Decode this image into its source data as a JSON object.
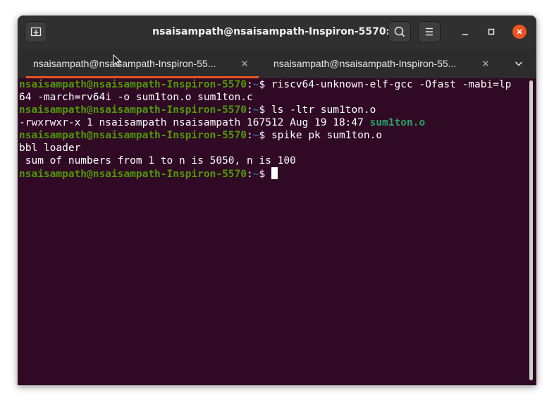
{
  "window": {
    "title": "nsaisampath@nsaisampath-Inspiron-5570: ~"
  },
  "tabs": [
    {
      "label": "nsaisampath@nsaisampath-Inspiron-55...",
      "active": true
    },
    {
      "label": "nsaisampath@nsaisampath-Inspiron-55...",
      "active": false
    }
  ],
  "colors": {
    "terminal_bg": "#300a24",
    "prompt_user": "#4e9a06",
    "prompt_path": "#3465a4",
    "accent": "#e95420"
  },
  "terminal": {
    "prompt_user_host": "nsaisampath@nsaisampath-Inspiron-5570",
    "prompt_sep": ":",
    "prompt_path": "~",
    "prompt_symbol": "$ ",
    "cmd1_part1": "riscv64-unknown-elf-gcc -Ofast -mabi=lp",
    "cmd1_part2": "64 -march=rv64i -o sum1ton.o sum1ton.c",
    "cmd2": "ls -ltr sum1ton.o",
    "ls_output_prefix": "-rwxrwxr-x 1 nsaisampath nsaisampath 167512 Aug 19 18:47 ",
    "ls_output_file": "sum1ton.o",
    "cmd3": "spike pk sum1ton.o",
    "out1": "bbl loader",
    "out2": " sum of numbers from 1 to n is 5050, n is 100"
  },
  "icons": {
    "new_tab": "new-tab-icon",
    "search": "search-icon",
    "menu": "hamburger-menu-icon",
    "minimize": "minimize-icon",
    "maximize": "maximize-icon",
    "close": "close-icon",
    "tab_list": "chevron-down-icon"
  }
}
